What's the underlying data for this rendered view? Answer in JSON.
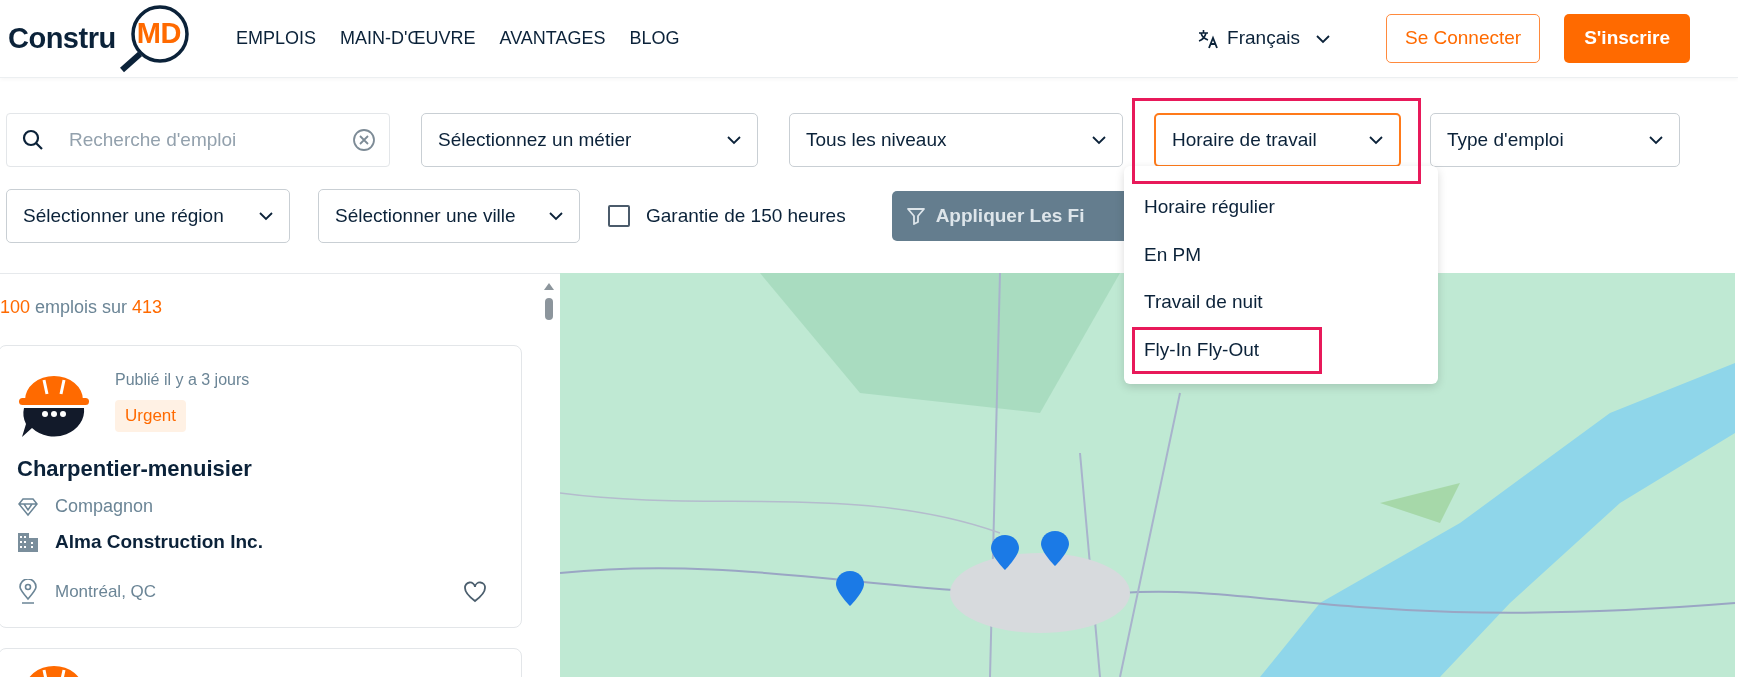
{
  "logo": {
    "text_left": "Constru",
    "text_right": "MD"
  },
  "nav": [
    {
      "label": "EMPLOIS"
    },
    {
      "label": "MAIN-D'ŒUVRE"
    },
    {
      "label": "AVANTAGES"
    },
    {
      "label": "BLOG"
    }
  ],
  "language": {
    "label": "Français"
  },
  "buttons": [
    {
      "label": "Se Connecter",
      "kind": "outline"
    },
    {
      "label": "S'inscrire",
      "kind": "solid"
    }
  ],
  "filter_rows": [
    {
      "items": [
        {
          "kind": "search",
          "placeholder": "Recherche d'emploi"
        },
        {
          "kind": "select",
          "label": "Sélectionnez un métier",
          "open": false,
          "highlighted": false
        },
        {
          "kind": "select",
          "label": "Tous les niveaux",
          "open": false,
          "highlighted": false
        },
        {
          "kind": "select",
          "label": "Horaire de travail",
          "open": true,
          "highlighted": true,
          "options": [
            {
              "label": "Horaire régulier",
              "highlighted": false
            },
            {
              "label": "En PM",
              "highlighted": false
            },
            {
              "label": "Travail de nuit",
              "highlighted": false
            },
            {
              "label": "Fly-In Fly-Out",
              "highlighted": true
            }
          ]
        },
        {
          "kind": "select",
          "label": "Type d'emploi",
          "open": false,
          "highlighted": false
        }
      ]
    },
    {
      "items": [
        {
          "kind": "select",
          "label": "Sélectionner une région",
          "open": false,
          "highlighted": false
        },
        {
          "kind": "select",
          "label": "Sélectionner une ville",
          "open": false,
          "highlighted": false
        },
        {
          "kind": "checkbox",
          "label": "Garantie de 150 heures",
          "checked": false
        },
        {
          "kind": "button",
          "label": "Appliquer Les Fi"
        }
      ]
    }
  ],
  "results": {
    "shown": "100",
    "text": "emplois sur",
    "total": "413"
  },
  "jobs": [
    {
      "cut_off": false,
      "posted": "Publié il y a 3 jours",
      "badge": "Urgent",
      "title": "Charpentier-menuisier",
      "experience": "Compagnon",
      "company": "Alma Construction Inc.",
      "location": "Montréal, QC",
      "favorite": false
    },
    {
      "cut_off": true
    }
  ]
}
